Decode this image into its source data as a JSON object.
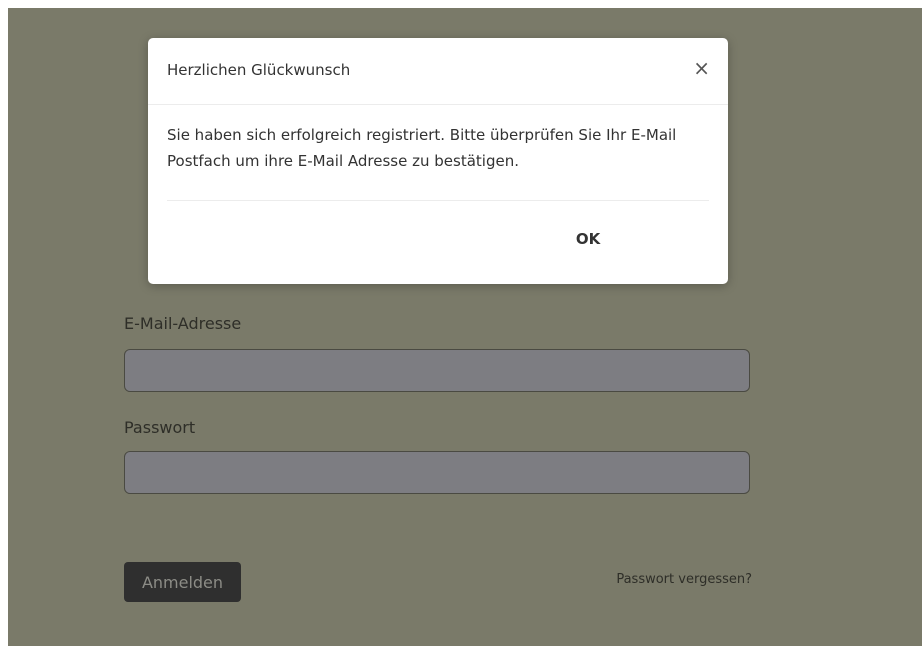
{
  "modal": {
    "title": "Herzlichen Glückwunsch",
    "close_label": "×",
    "message": "Sie haben sich erfolgreich registriert. Bitte überprüfen Sie Ihr E-Mail Postfach um ihre E-Mail Adresse zu bestätigen.",
    "ok_label": "OK"
  },
  "form": {
    "email_label": "E-Mail-Adresse",
    "email_value": "",
    "password_label": "Passwort",
    "password_value": "",
    "login_label": "Anmelden",
    "forgot_label": "Passwort vergessen?"
  },
  "colors": {
    "backdrop": "#7a7a69",
    "modal_bg": "#ffffff",
    "button_bg": "#2f2f2f"
  }
}
